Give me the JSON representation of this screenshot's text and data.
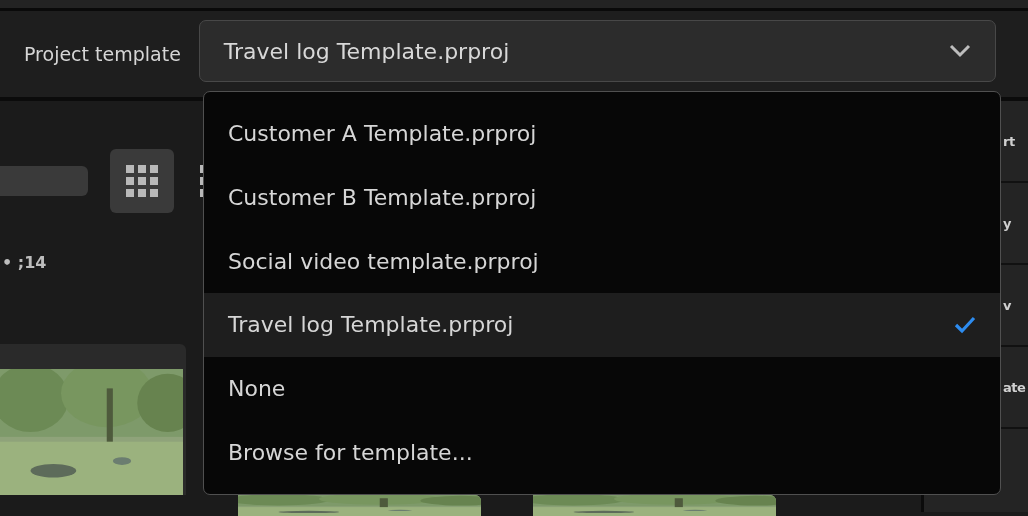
{
  "header": {
    "label": "Project template",
    "select": {
      "value": "Travel log Template.prproj",
      "expanded": true
    }
  },
  "menu": {
    "items": [
      {
        "label": "Customer A Template.prproj",
        "selected": false
      },
      {
        "label": "Customer B Template.prproj",
        "selected": false
      },
      {
        "label": "Social video template.prproj",
        "selected": false
      },
      {
        "label": "Travel log Template.prproj",
        "selected": true
      },
      {
        "label": "None",
        "selected": false
      },
      {
        "label": "Browse for template...",
        "selected": false
      }
    ]
  },
  "browser": {
    "timecode": "• ;14",
    "view_buttons": [
      {
        "kind": "grid",
        "selected": true
      },
      {
        "kind": "list",
        "selected": false
      }
    ]
  },
  "side_panel": {
    "rows": [
      "rt",
      "y",
      "v",
      "ate"
    ]
  }
}
